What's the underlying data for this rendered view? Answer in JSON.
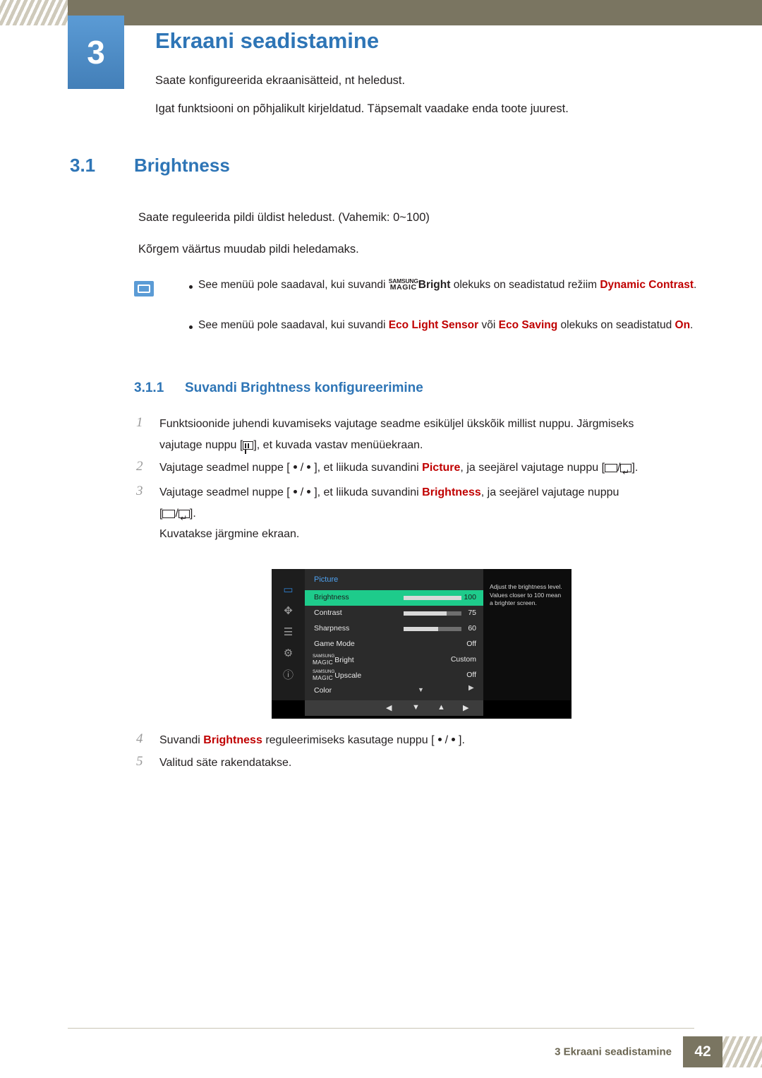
{
  "header": {
    "chapter_number": "3",
    "chapter_title": "Ekraani seadistamine",
    "intro_line_1": "Saate konfigureerida ekraanisätteid, nt heledust.",
    "intro_line_2": "Igat funktsiooni on põhjalikult kirjeldatud. Täpsemalt vaadake enda toote juurest."
  },
  "section": {
    "number": "3.1",
    "title": "Brightness",
    "paragraph_1": "Saate reguleerida pildi üldist heledust. (Vahemik: 0~100)",
    "paragraph_2": "Kõrgem väärtus muudab pildi heledamaks."
  },
  "note": {
    "item1": {
      "before": "See menüü pole saadaval, kui suvandi",
      "magic_line1": "SAMSUNG",
      "magic_line2": "MAGIC",
      "magic_suffix": "Bright",
      "middle": "olekuks on seadistatud režiim",
      "highlight": "Dynamic Contrast",
      "end": "."
    },
    "item2": {
      "before": "See menüü pole saadaval, kui suvandi",
      "highlight1": "Eco Light Sensor",
      "middle1": "või",
      "highlight2": "Eco Saving",
      "middle2": "olekuks on seadistatud",
      "highlight3": "On",
      "end": "."
    }
  },
  "subsection": {
    "number": "3.1.1",
    "title": "Suvandi Brightness konfigureerimine"
  },
  "steps": [
    {
      "num": "1",
      "line1_a": "Funktsioonide juhendi kuvamiseks vajutage seadme esiküljel ükskõik millist nuppu. Järgmiseks",
      "line2_a": "vajutage nuppu [",
      "line2_b": "], et kuvada vastav menüüekraan."
    },
    {
      "num": "2",
      "a": "Vajutage seadmel nuppe [",
      "b": "/",
      "c": "], et liikuda suvandini",
      "hl": "Picture",
      "d": ", ja seejärel vajutage nuppu [",
      "e": "/",
      "f": "]."
    },
    {
      "num": "3",
      "a": "Vajutage seadmel nuppe [",
      "b": "/",
      "c": "], et liikuda suvandini",
      "hl": "Brightness",
      "d": ", ja seejärel vajutage nuppu",
      "e": "[",
      "f": "/",
      "g": "].",
      "after": "Kuvatakse järgmine ekraan."
    },
    {
      "num": "4",
      "a": "Suvandi",
      "hl": "Brightness",
      "b": "reguleerimiseks kasutage nuppu [",
      "c": "/",
      "d": "]."
    },
    {
      "num": "5",
      "a": "Valitud säte rakendatakse."
    }
  ],
  "osd": {
    "menu_title": "Picture",
    "side_icons": [
      "monitor-icon",
      "picture-size-icon",
      "menu-lines-icon",
      "gear-icon",
      "info-icon"
    ],
    "rows": [
      {
        "label": "Brightness",
        "value": "100",
        "bar": 100,
        "highlight": true
      },
      {
        "label": "Contrast",
        "value": "75",
        "bar": 75,
        "highlight": false
      },
      {
        "label": "Sharpness",
        "value": "60",
        "bar": 60,
        "highlight": false
      },
      {
        "label": "Game Mode",
        "value": "Off",
        "bar": null,
        "highlight": false
      },
      {
        "label": "Bright",
        "value": "Custom",
        "bar": null,
        "highlight": false,
        "magic_l1": "SAMSUNG",
        "magic_l2": "MAGIC"
      },
      {
        "label": "Upscale",
        "value": "Off",
        "bar": null,
        "highlight": false,
        "magic_l1": "SAMSUNG",
        "magic_l2": "MAGIC"
      },
      {
        "label": "Color",
        "value": "",
        "bar": null,
        "highlight": false
      }
    ],
    "help_text": "Adjust the brightness level. Values closer to 100 mean a brighter screen.",
    "nav_glyphs": [
      "◀",
      "▼",
      "▲",
      "▶"
    ]
  },
  "footer": {
    "text": "3 Ekraani seadistamine",
    "page": "42"
  }
}
